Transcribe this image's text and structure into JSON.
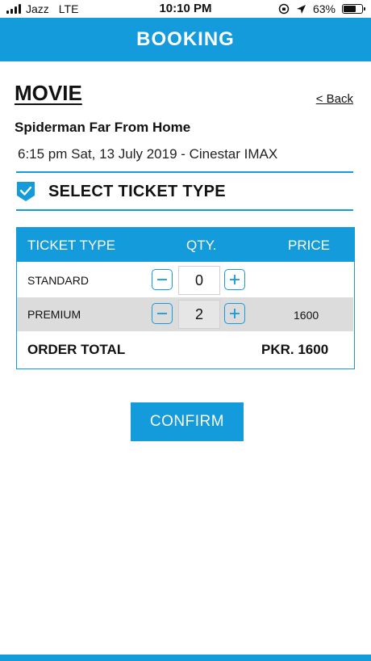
{
  "status_bar": {
    "carrier": "Jazz",
    "network": "LTE",
    "time": "10:10 PM",
    "battery": "63%",
    "battery_level": 0.63
  },
  "header": {
    "title": "BOOKING"
  },
  "movie": {
    "section_title": "MOVIE",
    "back_label": "< Back",
    "name": "Spiderman Far From Home",
    "showtime": "6:15 pm Sat, 13 July 2019 - Cinestar IMAX"
  },
  "ticket_section": {
    "label": "SELECT TICKET TYPE"
  },
  "table": {
    "headers": [
      "TICKET TYPE",
      "QTY.",
      "PRICE"
    ],
    "rows": [
      {
        "type": "STANDARD",
        "qty": "0",
        "price": ""
      },
      {
        "type": "PREMIUM",
        "qty": "2",
        "price": "1600"
      }
    ],
    "total_label": "ORDER TOTAL",
    "total_value": "PKR. 1600"
  },
  "confirm_label": "CONFIRM",
  "colors": {
    "accent": "#139bdb",
    "row_alt": "#dcdcdc"
  }
}
